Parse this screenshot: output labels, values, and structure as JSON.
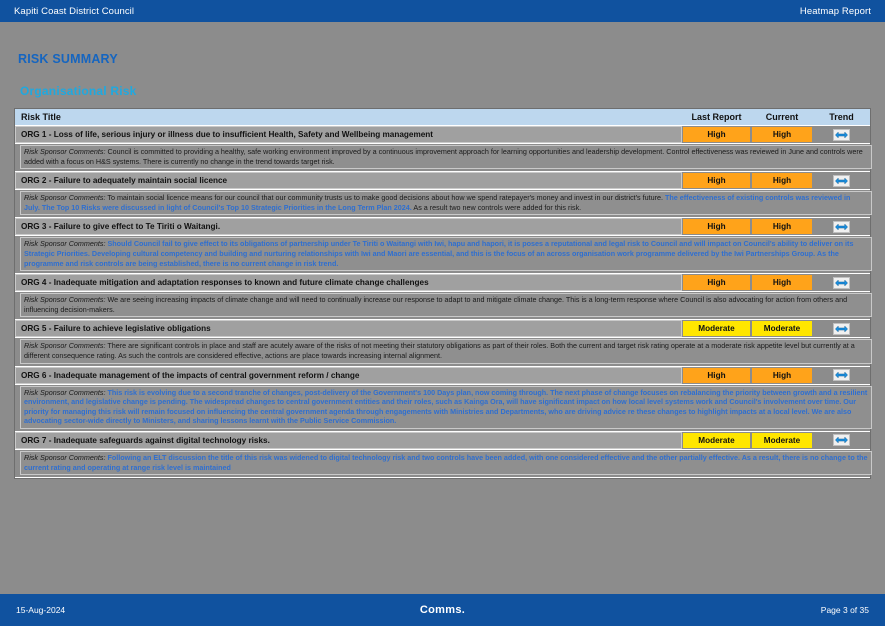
{
  "topbar": {
    "left_label": "Kapiti Coast District Council",
    "right_label": "Heatmap Report",
    "bg_color": "#10529f"
  },
  "page": {
    "section_title": "RISK SUMMARY",
    "section_title_color": "#1565c0",
    "subsection_title": "Organisational Risk",
    "subsection_title_color": "#1fa9e0",
    "background_color": "#8c8c8c"
  },
  "table": {
    "headers": {
      "risk_title": "Risk Title",
      "last_report": "Last Report",
      "current": "Current",
      "trend": "Trend"
    },
    "header_bg": "#bdd7ee",
    "rating_colors": {
      "High": "#ffa31a",
      "Moderate": "#ffe600"
    },
    "trend_icon": "left-right-arrow-icon",
    "rows": [
      {
        "title": "ORG 1 - Loss of life, serious injury or illness due to insufficient Health, Safety and Wellbeing management",
        "last_report": "High",
        "current": "High",
        "trend": "no-change",
        "comment_label": "Risk Sponsor Comments:",
        "comment_plain_1": " Council is committed to providing a healthy, safe working environment improved by a continuous improvement approach for learning opportunities and leadership development.  Control effectiveness was reviewed in June and controls were added with a focus on H&S systems. There is currently no change in the trend towards target risk.",
        "comment_highlight": "",
        "comment_plain_2": ""
      },
      {
        "title": "ORG 2 - Failure to adequately maintain social licence",
        "last_report": "High",
        "current": "High",
        "trend": "no-change",
        "comment_label": "Risk Sponsor Comments:",
        "comment_plain_1": " To maintain social licence means for our council that our community trusts us to make good decisions about how we spend ratepayer's money and invest in our district's future. ",
        "comment_highlight": "The effectiveness of existing controls was reviewed in July. The Top 10 Risks were discussed in light of Council's Top 10 Strategic Priorities in the Long Term Plan 2024.",
        "comment_plain_2": " As a result two new controls were added for this risk."
      },
      {
        "title": "ORG 3 - Failure to give effect to Te Tiriti o Waitangi.",
        "last_report": "High",
        "current": "High",
        "trend": "no-change",
        "comment_label": "Risk Sponsor Comments:",
        "comment_plain_1": " ",
        "comment_highlight": "Should Council fail to give effect to its obligations of partnership under Te Tiriti o Waitangi with Iwi, hapu and hapori, it is poses a reputational and legal risk to Council and will impact on Council's ability to deliver on its Strategic Priorities. Developing cultural competency and building and nurturing relationships with Iwi and Maori are essential, and this is the focus of an across organisation work programme delivered by the Iwi Partnerships Group. As the programme and risk controls are being established, there is no current change in risk trend.",
        "comment_plain_2": ""
      },
      {
        "title": "ORG 4 - Inadequate mitigation and adaptation responses to known and future climate change challenges",
        "last_report": "High",
        "current": "High",
        "trend": "no-change",
        "comment_label": "Risk Sponsor Comments:",
        "comment_plain_1": " We are seeing increasing impacts of climate change and will need to continually increase our response to adapt to and mitigate climate change. This is a long-term response where Council is also advocating for action from others and influencing decision-makers.",
        "comment_highlight": "",
        "comment_plain_2": ""
      },
      {
        "title": "ORG 5 - Failure to achieve legislative obligations",
        "last_report": "Moderate",
        "current": "Moderate",
        "trend": "no-change",
        "comment_label": "Risk Sponsor Comments:",
        "comment_plain_1": " There are significant controls in place and staff are acutely aware of the risks of not meeting their statutory obligations as part of their roles. Both the current and target risk rating operate at a moderate risk appetite level but currently at a different consequence rating. As such the controls are considered effective, actions are place towards increasing internal alignment.",
        "comment_highlight": "",
        "comment_plain_2": ""
      },
      {
        "title": "ORG 6 - Inadequate management of the impacts of central government reform / change",
        "last_report": "High",
        "current": "High",
        "trend": "no-change",
        "comment_label": "Risk Sponsor Comments:",
        "comment_plain_1": " ",
        "comment_highlight": "This risk is evolving due to a second tranche of changes, post-delivery of the Government's 100 Days plan, now coming through. The next phase of change focuses on rebalancing the priority between growth and a resilient environment, and legislative change is pending. The widespread changes to central government entities and their roles, such as Kainga Ora, will have significant impact on how local level systems work and Council's involvement over time.  Our priority for managing this risk will remain focused on influencing the central government agenda through engagements with Ministries and Departments, who are driving advice re these changes to highlight impacts at a local level. We are also advocating sector-wide directly to Ministers, and sharing lessons learnt with the Public Service Commission.",
        "comment_plain_2": ""
      },
      {
        "title": "ORG 7 - Inadequate safeguards against digital technology risks.",
        "last_report": "Moderate",
        "current": "Moderate",
        "trend": "no-change",
        "comment_label": "Risk Sponsor Comments:",
        "comment_plain_1": " ",
        "comment_highlight": "Following an ELT discussion the title of this risk was widened to digital technology risk and two controls have been added, with one considered effective and the other partially effective. As a result, there is no change to the current rating and operating at range risk level is maintained",
        "comment_plain_2": ""
      }
    ]
  },
  "footer": {
    "date": "15-Aug-2024",
    "center_label": "Comms.",
    "page_label": "Page 3 of 35",
    "bg_color": "#10529f"
  }
}
